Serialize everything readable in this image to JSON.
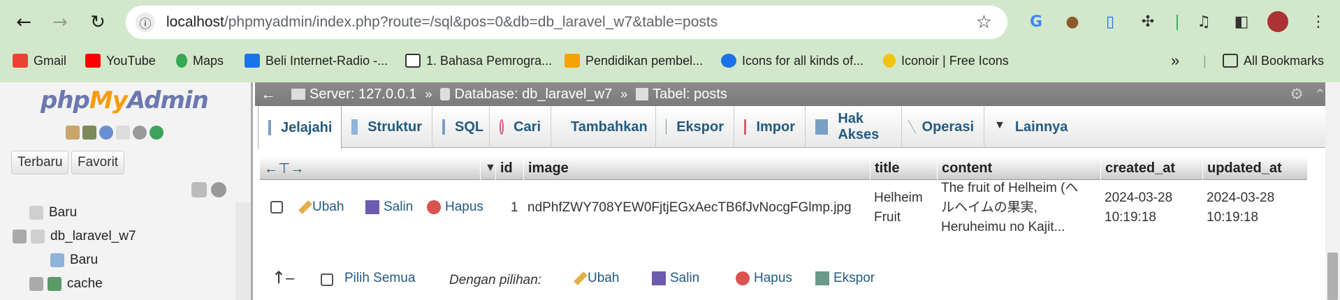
{
  "browser": {
    "url_host": "localhost",
    "url_path": "/phpmyadmin/index.php?route=/sql&pos=0&db=db_laravel_w7&table=posts",
    "bookmarks": [
      {
        "label": "Gmail",
        "icon": "gmail-icon",
        "color": "#ea4335"
      },
      {
        "label": "YouTube",
        "icon": "youtube-icon",
        "color": "#ff0000"
      },
      {
        "label": "Maps",
        "icon": "maps-icon",
        "color": "#34a853"
      },
      {
        "label": "Beli Internet-Radio -...",
        "icon": "radio-icon",
        "color": "#1a73e8"
      },
      {
        "label": "1. Bahasa Pemrogra...",
        "icon": "book-icon",
        "color": "#333333"
      },
      {
        "label": "Pendidikan pembel...",
        "icon": "pendidikan-icon",
        "color": "#f4a300"
      },
      {
        "label": "Icons for all kinds of...",
        "icon": "fontawesome-icon",
        "color": "#1a73e8"
      },
      {
        "label": "Iconoir | Free Icons",
        "icon": "iconoir-icon",
        "color": "#f1c40f"
      }
    ],
    "all_bookmarks": "All Bookmarks"
  },
  "sidebar": {
    "logo_php": "php",
    "logo_my": "My",
    "logo_admin": "Admin",
    "btn_recent": "Terbaru",
    "btn_favorite": "Favorit",
    "tree": [
      {
        "label": "Baru",
        "level": 1
      },
      {
        "label": "db_laravel_w7",
        "level": 1
      },
      {
        "label": "Baru",
        "level": 2
      },
      {
        "label": "cache",
        "level": 2
      }
    ]
  },
  "breadcrumb": {
    "server": "Server: 127.0.0.1",
    "database": "Database: db_laravel_w7",
    "table": "Tabel: posts"
  },
  "tabs": [
    {
      "label": "Jelajahi",
      "active": true
    },
    {
      "label": "Struktur"
    },
    {
      "label": "SQL"
    },
    {
      "label": "Cari"
    },
    {
      "label": "Tambahkan"
    },
    {
      "label": "Ekspor"
    },
    {
      "label": "Impor"
    },
    {
      "label": "Hak Akses"
    },
    {
      "label": "Operasi"
    },
    {
      "label": "Lainnya"
    }
  ],
  "table": {
    "columns": [
      "id",
      "image",
      "title",
      "content",
      "created_at",
      "updated_at"
    ],
    "row": {
      "actions": [
        "Ubah",
        "Salin",
        "Hapus"
      ],
      "id": "1",
      "image": "ndPhfZWY708YEW0FjtjEGxAecTB6fJvNocgFGlmp.jpg",
      "title_line1": "Helheim",
      "title_line2": "Fruit",
      "content_line1": "The fruit of Helheim (ヘ",
      "content_line2": "ルヘイムの果実,",
      "content_line3": "Heruheimu no Kajit...",
      "created_line1": "2024-03-28",
      "created_line2": "10:19:18",
      "updated_line1": "2024-03-28",
      "updated_line2": "10:19:18"
    }
  },
  "bulk": {
    "select_all": "Pilih Semua",
    "with_selected": "Dengan pilihan:",
    "edit": "Ubah",
    "copy": "Salin",
    "delete": "Hapus",
    "export": "Ekspor"
  }
}
